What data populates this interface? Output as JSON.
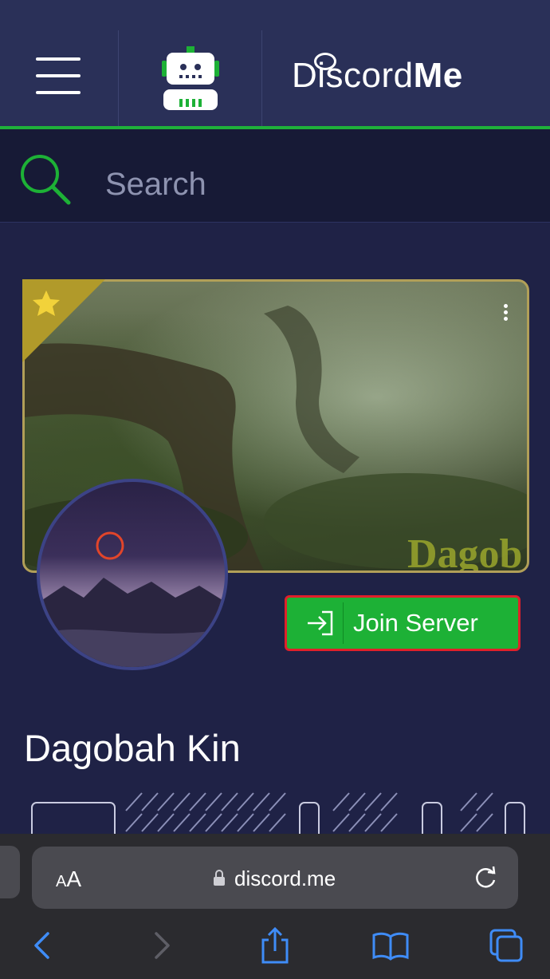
{
  "header": {
    "logo_text_light": "Discord",
    "logo_text_bold": "Me"
  },
  "search": {
    "placeholder": "Search"
  },
  "server": {
    "name": "Dagobah Kin",
    "join_label": "Join Server",
    "banner_watermark": "Dagob"
  },
  "browser": {
    "aa_small": "A",
    "aa_large": "A",
    "url": "discord.me"
  },
  "colors": {
    "brand_green": "#1db136",
    "header_bg": "#2a3058",
    "page_bg": "#1f2246",
    "banner_border": "#b19f58",
    "highlight_red": "#e0202a",
    "ios_blue": "#3f8cf7"
  }
}
